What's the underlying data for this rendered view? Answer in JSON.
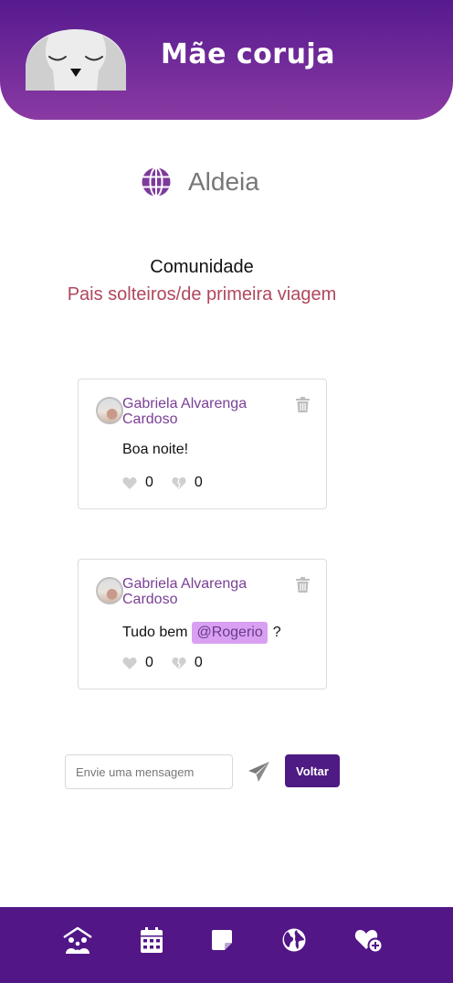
{
  "header": {
    "title": "Mãe coruja"
  },
  "section": {
    "title": "Aldeia",
    "icon": "globe-icon"
  },
  "community": {
    "label": "Comunidade",
    "name": "Pais solteiros/de primeira viagem"
  },
  "posts": [
    {
      "author": "Gabriela Alvarenga Cardoso",
      "text": "Boa noite!",
      "mention": "",
      "suffix": "",
      "likes": "0",
      "dislikes": "0"
    },
    {
      "author": "Gabriela Alvarenga Cardoso",
      "text": "Tudo bem",
      "mention": "@Rogerio",
      "suffix": "?",
      "likes": "0",
      "dislikes": "0"
    }
  ],
  "composer": {
    "placeholder": "Envie uma mensagem",
    "value": "",
    "back_label": "Voltar"
  },
  "bottom_nav": [
    {
      "icon": "family-home-icon"
    },
    {
      "icon": "calendar-icon"
    },
    {
      "icon": "note-icon"
    },
    {
      "icon": "globe-icon"
    },
    {
      "icon": "heart-plus-icon"
    }
  ],
  "colors": {
    "primary": "#521687",
    "accent": "#7a3f96",
    "community": "#b0465c",
    "mention_bg": "#d9a0f2"
  }
}
